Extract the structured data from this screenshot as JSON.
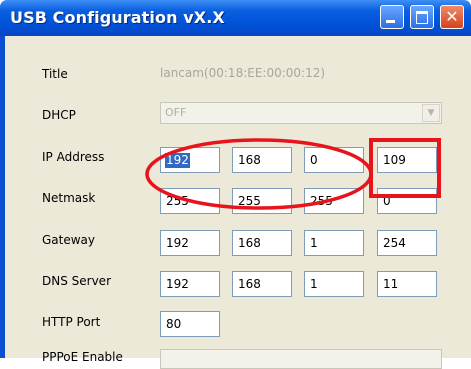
{
  "window": {
    "title": "USB Configuration   vX.X",
    "close_glyph": "✕"
  },
  "form": {
    "title_label": "Title",
    "title_value": "lancam(00:18:EE:00:00:12)",
    "dhcp_label": "DHCP",
    "dhcp_value": "OFF",
    "ip_label": "IP Address",
    "ip": [
      "192",
      "168",
      "0",
      "109"
    ],
    "netmask_label": "Netmask",
    "netmask": [
      "255",
      "255",
      "255",
      "0"
    ],
    "gateway_label": "Gateway",
    "gateway": [
      "192",
      "168",
      "1",
      "254"
    ],
    "dns_label": "DNS Server",
    "dns": [
      "192",
      "168",
      "1",
      "11"
    ],
    "http_label": "HTTP Port",
    "http_port": "80",
    "pppoe_label": "PPPoE Enable"
  },
  "annotations": {
    "color": "#e8141c"
  }
}
